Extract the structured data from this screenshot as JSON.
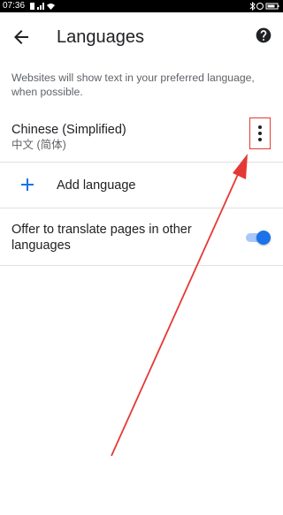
{
  "statusbar": {
    "time": "07:36",
    "icons_left": [
      "sim-icon",
      "signal-icon",
      "wifi-icon"
    ],
    "icons_right": [
      "bluetooth-icon",
      "alarm-icon",
      "battery-icon"
    ]
  },
  "appbar": {
    "title": "Languages",
    "back_icon": "arrow-back-icon",
    "help_icon": "help-icon"
  },
  "description": "Websites will show text in your preferred language, when possible.",
  "languages": [
    {
      "name": "Chinese (Simplified)",
      "native": "中文 (简体)",
      "menu_icon": "more-vert-icon"
    }
  ],
  "add_language": {
    "label": "Add language",
    "icon": "plus-icon"
  },
  "translate_offer": {
    "label": "Offer to translate pages in other languages",
    "enabled": true
  },
  "annotation": {
    "highlight_color": "#e53935",
    "arrow_color": "#e53935"
  },
  "colors": {
    "accent": "#1a73e8",
    "text_primary": "#202124",
    "text_secondary": "#5f6368"
  }
}
